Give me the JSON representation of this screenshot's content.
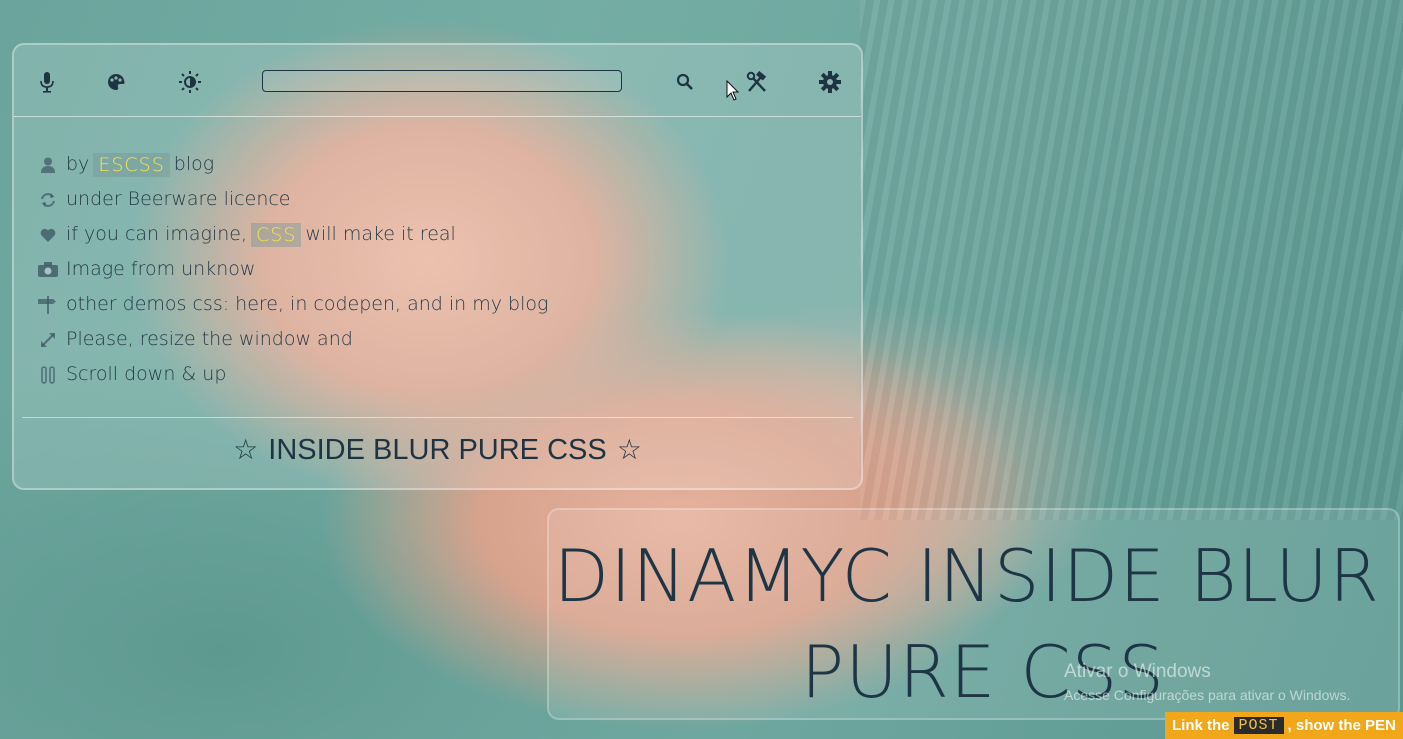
{
  "search": {
    "value": "",
    "placeholder": ""
  },
  "toolbar": {
    "icons": {
      "mic": "microphone-icon",
      "palette": "palette-icon",
      "brightness": "brightness-icon",
      "search": "search-icon",
      "tools": "tools-icon",
      "settings": "gear-icon"
    }
  },
  "credits": [
    {
      "icon": "user-icon",
      "before": "by",
      "highlight": "ESCSS",
      "after": "blog"
    },
    {
      "icon": "refresh-icon",
      "text": "under Beerware licence"
    },
    {
      "icon": "heart-icon",
      "before": "if you can imagine,",
      "highlight": "CSS",
      "after": "will make it real"
    },
    {
      "icon": "camera-icon",
      "text": "Image from unknow"
    },
    {
      "icon": "signpost-icon",
      "text": "other demos css: here, in codepen, and in my blog"
    },
    {
      "icon": "expand-icon",
      "text": "Please, resize the window and"
    },
    {
      "icon": "scroll-icon",
      "text": "Scroll down & up"
    }
  ],
  "panel_title": {
    "star": "☆",
    "text": "INSIDE BLUR PURE CSS"
  },
  "big_title": {
    "line1": "DINAMYC INSIDE BLUR",
    "line2": "PURE CSS"
  },
  "watermark": {
    "title": "Ativar o Windows",
    "subtitle": "Acesse Configurações para ativar o Windows."
  },
  "link_bar": {
    "before": "Link the",
    "post": "POST",
    "after": ", show the PEN"
  },
  "colors": {
    "highlight": "#f3e44d",
    "link_bar": "#f2a71b",
    "text": "#1f3443"
  }
}
